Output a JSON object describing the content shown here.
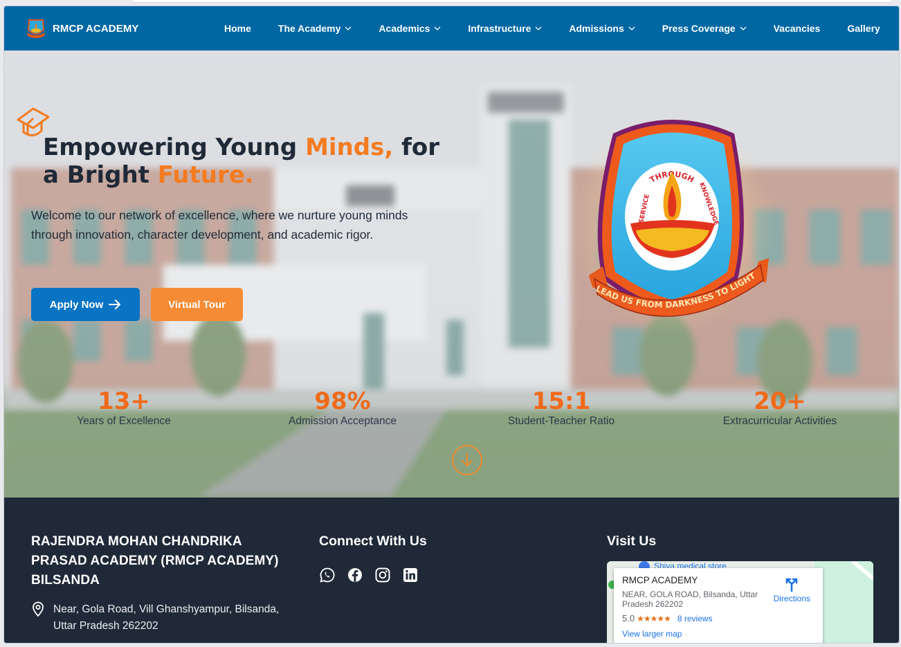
{
  "nav": {
    "brand": "RMCP ACADEMY",
    "items": [
      {
        "label": "Home",
        "dropdown": false
      },
      {
        "label": "The Academy",
        "dropdown": true
      },
      {
        "label": "Academics",
        "dropdown": true
      },
      {
        "label": "Infrastructure",
        "dropdown": true
      },
      {
        "label": "Admissions",
        "dropdown": true
      },
      {
        "label": "Press Coverage",
        "dropdown": true
      },
      {
        "label": "Vacancies",
        "dropdown": false
      },
      {
        "label": "Gallery",
        "dropdown": false
      }
    ]
  },
  "hero": {
    "title_part1": "Empowering Young ",
    "title_hl1": "Minds,",
    "title_part2": " for a Bright ",
    "title_hl2": "Future.",
    "subtitle": "Welcome to our network of excellence, where we nurture young minds through innovation, character development, and academic rigor.",
    "apply_label": "Apply Now",
    "tour_label": "Virtual Tour",
    "emblem": {
      "arc_text": "THROUGH",
      "left_text": "SERVICE",
      "right_text": "KNOWLEDGE",
      "ribbon_text": "LEAD US FROM DARKNESS TO LIGHT"
    }
  },
  "stats": [
    {
      "value": "13+",
      "label": "Years of Excellence"
    },
    {
      "value": "98%",
      "label": "Admission Acceptance"
    },
    {
      "value": "15:1",
      "label": "Student-Teacher Ratio"
    },
    {
      "value": "20+",
      "label": "Extracurricular Activities"
    }
  ],
  "footer": {
    "school_name": "RAJENDRA MOHAN CHANDRIKA PRASAD ACADEMY (RMCP ACADEMY) BILSANDA",
    "address": "Near, Gola Road, Vill Ghanshyampur, Bilsanda, Uttar Pradesh 262202",
    "connect_heading": "Connect With Us",
    "socials": [
      "whatsapp-icon",
      "facebook-icon",
      "instagram-icon",
      "linkedin-icon"
    ],
    "visit_heading": "Visit Us",
    "map": {
      "place_label": "Shiva medical store",
      "title": "RMCP ACADEMY",
      "address": "NEAR, GOLA ROAD, Bilsanda, Uttar Pradesh 262202",
      "rating": "5.0",
      "stars": "★★★★★",
      "reviews": "8 reviews",
      "directions": "Directions",
      "larger": "View larger map"
    }
  },
  "colors": {
    "nav_bg": "#0067a3",
    "accent_orange": "#f47b20",
    "apply_blue": "#0a74c4",
    "footer_bg": "#1f2937"
  }
}
